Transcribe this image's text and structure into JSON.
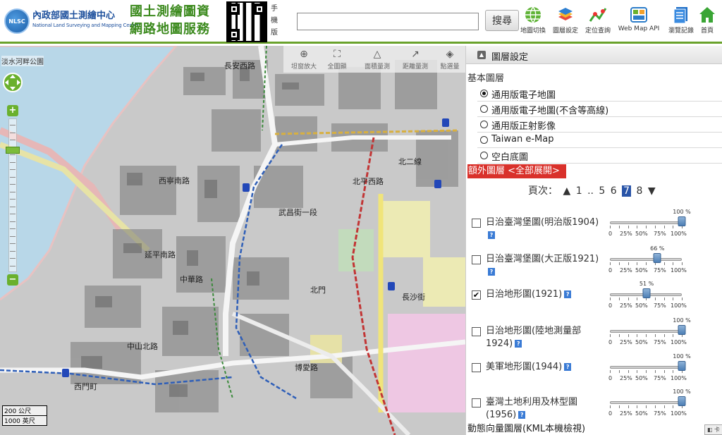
{
  "header": {
    "logo_text": "NLSC",
    "org_name": "內政部國土測繪中心",
    "org_name_en": "National Land Surveying and Mapping Center",
    "service_title_line1": "國土測繪圖資",
    "service_title_line2": "網路地圖服務",
    "qr_label": "手機版",
    "search_placeholder": "",
    "search_button": "搜尋",
    "tools": [
      {
        "label": "地圖切換",
        "icon": "globe-icon"
      },
      {
        "label": "圖層設定",
        "icon": "layers-icon"
      },
      {
        "label": "定位查詢",
        "icon": "locate-icon"
      },
      {
        "label": "Web Map API",
        "icon": "api-icon"
      },
      {
        "label": "瀏覽記錄",
        "icon": "history-icon"
      },
      {
        "label": "首頁",
        "icon": "home-icon"
      }
    ]
  },
  "map": {
    "place_label": "淡水河畔公園",
    "toolbar": [
      {
        "label": "坦窗放大",
        "icon": "zoom-box-icon"
      },
      {
        "label": "全圖顯",
        "icon": "full-extent-icon"
      },
      {
        "label": "面積量測",
        "icon": "area-measure-icon"
      },
      {
        "label": "距離量測",
        "icon": "distance-measure-icon"
      },
      {
        "label": "點選量",
        "icon": "point-query-icon"
      }
    ],
    "zoom_in": "+",
    "zoom_out": "−",
    "scale_top": "200 公尺",
    "scale_bottom": "1000 英尺",
    "street_labels": [
      "長安西路",
      "北平西路",
      "武昌街一段",
      "北門",
      "西寧南路",
      "中華路",
      "延平南路",
      "北二線",
      "西門町",
      "長沙街",
      "中山北路",
      "博愛路"
    ]
  },
  "panel": {
    "title": "圖層設定",
    "base_label": "基本圖層",
    "base_options": [
      {
        "label": "通用版電子地圖",
        "selected": true
      },
      {
        "label": "通用版電子地圖(不含等高線)",
        "selected": false
      },
      {
        "label": "通用版正射影像",
        "selected": false
      },
      {
        "label": "Taiwan e-Map",
        "selected": false
      },
      {
        "label": "空白底圖",
        "selected": false
      }
    ],
    "extra_label": "額外圖層 <全部展開>",
    "pager": {
      "label": "頁次：",
      "prev": "▲",
      "first": "1",
      "ellipsis": "..",
      "pages": [
        "5",
        "6",
        "7",
        "8"
      ],
      "current": "7",
      "next": "▼"
    },
    "scale_ticks": [
      "0",
      "25%",
      "50%",
      "75%",
      "100%"
    ],
    "layers": [
      {
        "name": "日治臺灣堡圖(明治版1904)",
        "checked": false,
        "opacity": 100,
        "opacity_label": "100 %"
      },
      {
        "name": "日治臺灣堡圖(大正版1921)",
        "checked": false,
        "opacity": 66,
        "opacity_label": "66 %"
      },
      {
        "name": "日治地形圖(1921)",
        "checked": true,
        "opacity": 51,
        "opacity_label": "51 %"
      },
      {
        "name": "日治地形圖(陸地測量部1924)",
        "checked": false,
        "opacity": 100,
        "opacity_label": "100 %"
      },
      {
        "name": "美軍地形圖(1944)",
        "checked": false,
        "opacity": 100,
        "opacity_label": "100 %"
      },
      {
        "name": "臺灣土地利用及林型圖(1956)",
        "checked": false,
        "opacity": 100,
        "opacity_label": "100 %"
      }
    ],
    "kml_label": "動態向量圖層(KML本機檢視)",
    "corner_button": "◧ 卡"
  },
  "colors": {
    "brand_green": "#6aa22c",
    "brand_blue": "#1c4f9c",
    "extra_bar_red": "#d9312b",
    "pager_current": "#2a55a8"
  }
}
